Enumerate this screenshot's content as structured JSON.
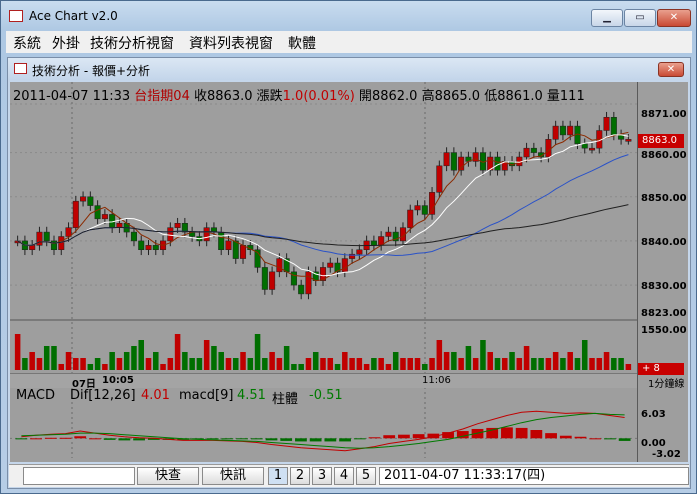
{
  "window": {
    "title": "Ace Chart v2.0"
  },
  "menu": [
    "系統",
    "外掛",
    "技術分析視窗",
    "資料列表視窗",
    "軟體"
  ],
  "child_window": {
    "title": "技術分析 - 報價+分析"
  },
  "quote": {
    "datetime": "2011-04-07 11:33",
    "symbol": "台指期04",
    "close_label": "收",
    "close": "8863.0",
    "change_label": "漲跌",
    "change": "1.0(0.01%)",
    "open_label": "開",
    "open": "8862.0",
    "high_label": "高",
    "high": "8865.0",
    "low_label": "低",
    "low": "8861.0",
    "vol_label": "量",
    "volume": "111"
  },
  "price_axis": {
    "labels": [
      "8871.00",
      "8860.00",
      "8850.00",
      "8840.00",
      "8830.00",
      "8823.00"
    ],
    "current": "8863.0"
  },
  "volume_axis": {
    "label": "1550.00",
    "current": "+ 8"
  },
  "time_axis": {
    "day": "07日",
    "start": "10:05",
    "mid": "11:06",
    "period": "1分鐘線"
  },
  "macd": {
    "name": "MACD",
    "dif_label": "Dif[12,26]",
    "dif": "4.01",
    "signal_label": "macd[9]",
    "signal": "4.51",
    "hist_label": "柱體",
    "hist": "-0.51",
    "axis": [
      "6.03",
      "0.00",
      "-3.02"
    ]
  },
  "status": {
    "quick_search": "快查",
    "news": "快訊",
    "pages": [
      "1",
      "2",
      "3",
      "4",
      "5"
    ],
    "clock": "2011-04-07 11:33:17(四)"
  },
  "colors": {
    "up": "#c00000",
    "down": "#006e00",
    "bg": "#9e9e9e",
    "ma_short": "#8b2a00",
    "ma_mid": "#ffffff",
    "ma_long1": "#2a52c8",
    "ma_long2": "#202020"
  },
  "chart_data": {
    "type": "candlestick",
    "ylim": [
      8823,
      8871
    ],
    "price": [
      8840,
      8838,
      8839,
      8842,
      8840,
      8838,
      8841,
      8843,
      8849,
      8850,
      8848,
      8845,
      8846,
      8843,
      8844,
      8842,
      8840,
      8838,
      8839,
      8838,
      8840,
      8843,
      8844,
      8842,
      8841,
      8840,
      8843,
      8842,
      8838,
      8840,
      8836,
      8839,
      8838,
      8834,
      8829,
      8833,
      8836,
      8833,
      8830,
      8828,
      8833,
      8831,
      8834,
      8835,
      8833,
      8836,
      8837,
      8838,
      8840,
      8839,
      8841,
      8842,
      8840,
      8843,
      8847,
      8848,
      8846,
      8851,
      8857,
      8860,
      8856,
      8859,
      8858,
      8860,
      8856,
      8859,
      8856,
      8858,
      8857,
      8859,
      8861,
      8860,
      8859,
      8863,
      8866,
      8864,
      8866,
      8862,
      8861,
      8861,
      8865,
      8868,
      8864,
      8863,
      8863
    ],
    "volume": [
      6,
      2,
      3,
      2,
      4,
      4,
      1,
      3,
      2,
      2,
      1,
      2,
      1,
      3,
      2,
      3,
      4,
      5,
      2,
      3,
      1,
      2,
      6,
      3,
      2,
      2,
      5,
      4,
      3,
      2,
      2,
      3,
      2,
      6,
      2,
      3,
      2,
      4,
      1,
      1,
      2,
      3,
      2,
      2,
      1,
      3,
      2,
      2,
      1,
      2,
      2,
      1,
      3,
      2,
      2,
      2,
      1,
      2,
      5,
      3,
      3,
      2,
      4,
      2,
      5,
      3,
      2,
      2,
      3,
      2,
      4,
      2,
      2,
      2,
      3,
      2,
      3,
      2,
      5,
      2,
      2,
      3,
      2,
      2,
      1
    ],
    "macd_dif": [
      0.3,
      0.6,
      0.8,
      0.9,
      1.4,
      1.0,
      0.6,
      0.3,
      0.1,
      0.0,
      -0.2,
      -0.4,
      -0.4,
      -0.4,
      -0.5,
      -0.6,
      -0.8,
      -1.2,
      -1.5,
      -1.8,
      -2.0,
      -2.2,
      -2.4,
      -2.0,
      -1.6,
      -1.0,
      -0.6,
      -0.2,
      0.3,
      1.0,
      1.8,
      2.8,
      3.6,
      4.4,
      5.0,
      5.2,
      5.0,
      4.8,
      4.9,
      4.8,
      4.4,
      4.0
    ],
    "macd_signal": [
      0.5,
      0.6,
      0.7,
      0.8,
      1.0,
      1.0,
      0.9,
      0.7,
      0.5,
      0.3,
      0.1,
      -0.1,
      -0.2,
      -0.3,
      -0.4,
      -0.5,
      -0.6,
      -0.8,
      -1.0,
      -1.2,
      -1.4,
      -1.6,
      -1.8,
      -1.9,
      -1.8,
      -1.6,
      -1.3,
      -1.0,
      -0.6,
      -0.2,
      0.4,
      1.0,
      1.6,
      2.3,
      3.0,
      3.6,
      4.0,
      4.3,
      4.6,
      4.8,
      4.6,
      4.5
    ]
  }
}
